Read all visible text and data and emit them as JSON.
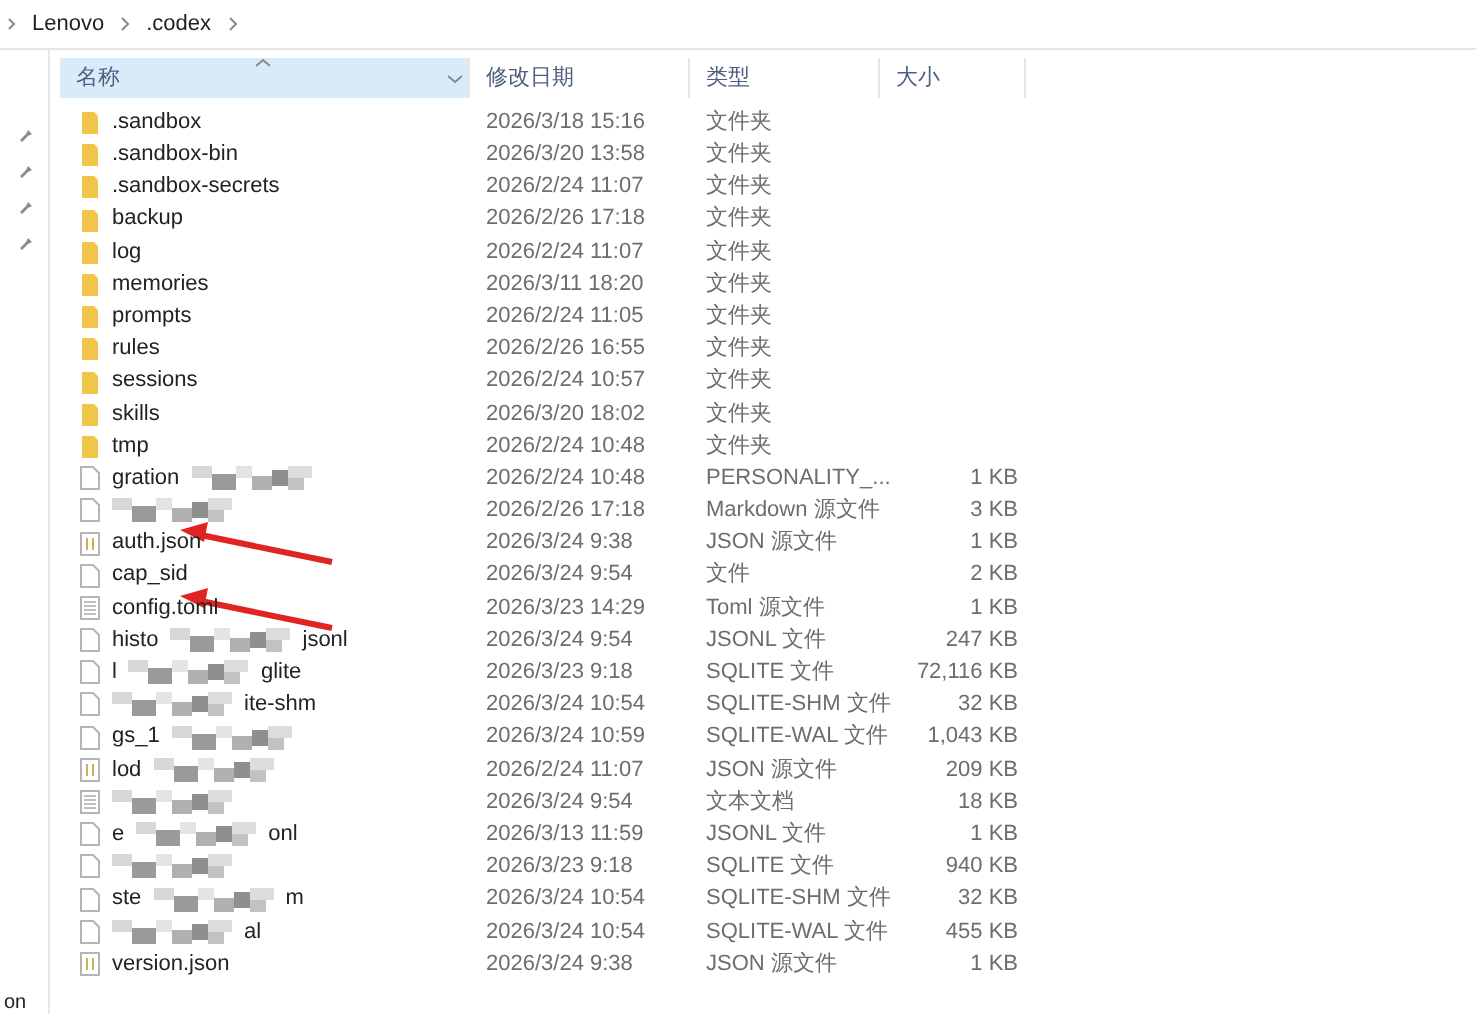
{
  "breadcrumb": [
    "Lenovo",
    ".codex"
  ],
  "columns": [
    {
      "label": "名称",
      "sorted": true
    },
    {
      "label": "修改日期",
      "sorted": false
    },
    {
      "label": "类型",
      "sorted": false
    },
    {
      "label": "大小",
      "sorted": false
    }
  ],
  "rows": [
    {
      "name": ".sandbox",
      "date": "2026/3/18 15:16",
      "type": "文件夹",
      "kind": "folder",
      "redacted": false
    },
    {
      "name": ".sandbox-bin",
      "date": "2026/3/20 13:58",
      "type": "文件夹",
      "kind": "folder",
      "redacted": false
    },
    {
      "name": ".sandbox-secrets",
      "date": "2026/2/24 11:07",
      "type": "文件夹",
      "kind": "folder",
      "redacted": false
    },
    {
      "name": "backup",
      "date": "2026/2/26 17:18",
      "type": "文件夹",
      "kind": "folder",
      "redacted": false
    },
    {
      "name": "log",
      "date": "2026/2/24 11:07",
      "type": "文件夹",
      "kind": "folder",
      "redacted": false
    },
    {
      "name": "memories",
      "date": "2026/3/11 18:20",
      "type": "文件夹",
      "kind": "folder",
      "redacted": false
    },
    {
      "name": "prompts",
      "date": "2026/2/24 11:05",
      "type": "文件夹",
      "kind": "folder",
      "redacted": false
    },
    {
      "name": "rules",
      "date": "2026/2/26 16:55",
      "type": "文件夹",
      "kind": "folder",
      "redacted": false
    },
    {
      "name": "sessions",
      "date": "2026/2/24 10:57",
      "type": "文件夹",
      "kind": "folder",
      "redacted": false
    },
    {
      "name": "skills",
      "date": "2026/3/20 18:02",
      "type": "文件夹",
      "kind": "folder",
      "redacted": false
    },
    {
      "name": "tmp",
      "date": "2026/2/24 10:48",
      "type": "文件夹",
      "kind": "folder",
      "redacted": false
    },
    {
      "name": "gration",
      "date": "2026/2/24 10:48",
      "type": "PERSONALITY_...",
      "size": "1 KB",
      "kind": "file",
      "redacted": true
    },
    {
      "date": "2026/2/26 17:18",
      "type": "Markdown 源文件",
      "size": "3 KB",
      "kind": "file",
      "redacted": true
    },
    {
      "name": "auth.json",
      "date": "2026/3/24 9:38",
      "type": "JSON 源文件",
      "size": "1 KB",
      "kind": "json",
      "redacted": false,
      "arrow": true
    },
    {
      "name": "cap_sid",
      "date": "2026/3/24 9:54",
      "type": "文件",
      "size": "2 KB",
      "kind": "file",
      "redacted": false
    },
    {
      "name": "config.toml",
      "date": "2026/3/23 14:29",
      "type": "Toml 源文件",
      "size": "1 KB",
      "kind": "text",
      "redacted": false,
      "arrow": true
    },
    {
      "name": "histo",
      "name_tail": "jsonl",
      "date": "2026/3/24 9:54",
      "type": "JSONL 文件",
      "size": "247 KB",
      "kind": "file",
      "redacted": true
    },
    {
      "name": "l",
      "name_tail": "glite",
      "date": "2026/3/23 9:18",
      "type": "SQLITE 文件",
      "size": "72,116 KB",
      "kind": "file",
      "redacted": true
    },
    {
      "name_tail": "ite-shm",
      "date": "2026/3/24 10:54",
      "type": "SQLITE-SHM 文件",
      "size": "32 KB",
      "kind": "file",
      "redacted": true
    },
    {
      "name": "gs_1",
      "date": "2026/3/24 10:59",
      "type": "SQLITE-WAL 文件",
      "size": "1,043 KB",
      "kind": "file",
      "redacted": true
    },
    {
      "name": "lod",
      "date": "2026/2/24 11:07",
      "type": "JSON 源文件",
      "size": "209 KB",
      "kind": "json",
      "redacted": true
    },
    {
      "date": "2026/3/24 9:54",
      "type": "文本文档",
      "size": "18 KB",
      "kind": "text",
      "redacted": true
    },
    {
      "name": "e",
      "name_tail": "onl",
      "date": "2026/3/13 11:59",
      "type": "JSONL 文件",
      "size": "1 KB",
      "kind": "file",
      "redacted": true
    },
    {
      "date": "2026/3/23 9:18",
      "type": "SQLITE 文件",
      "size": "940 KB",
      "kind": "file",
      "redacted": true
    },
    {
      "name": "ste",
      "name_tail": "m",
      "date": "2026/3/24 10:54",
      "type": "SQLITE-SHM 文件",
      "size": "32 KB",
      "kind": "file",
      "redacted": true
    },
    {
      "name_tail": "al",
      "date": "2026/3/24 10:54",
      "type": "SQLITE-WAL 文件",
      "size": "455 KB",
      "kind": "file",
      "redacted": true
    },
    {
      "name": "version.json",
      "date": "2026/3/24 9:38",
      "type": "JSON 源文件",
      "size": "1 KB",
      "kind": "json",
      "redacted": false
    }
  ],
  "nav_fragment": "on"
}
